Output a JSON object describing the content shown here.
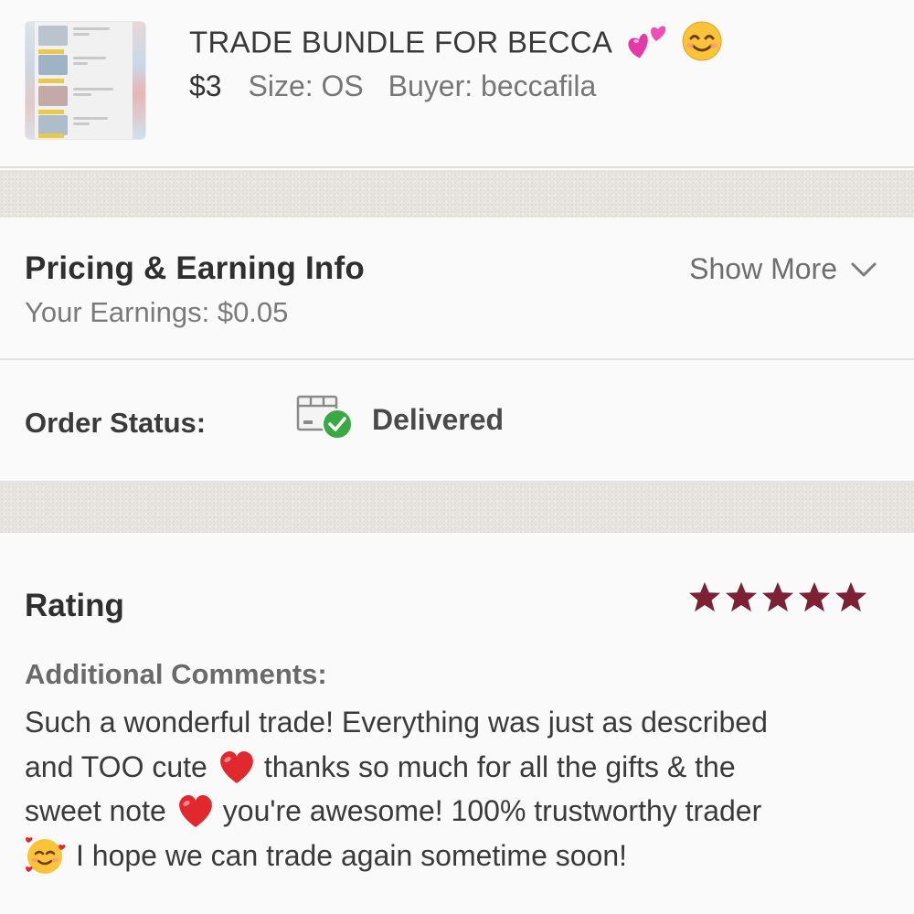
{
  "listing": {
    "title": "TRADE BUNDLE FOR BECCA",
    "price": "$3",
    "size": "Size: OS",
    "buyer": "Buyer: beccafila",
    "title_emojis": [
      "two-hearts-icon",
      "smiling-face-icon"
    ]
  },
  "pricing": {
    "title": "Pricing & Earning Info",
    "earnings": "Your Earnings: $0.05",
    "show_more": "Show More"
  },
  "order": {
    "label": "Order Status:",
    "status": "Delivered",
    "status_icon": "package-delivered-icon"
  },
  "rating": {
    "title": "Rating",
    "stars": 5,
    "star_color": "#7b2133",
    "comments_label": "Additional Comments:",
    "comment_lines": [
      "Such a wonderful trade! Everything was just as described",
      "and TOO cute",
      "thanks so much for all the gifts & the",
      "sweet note",
      "you're awesome! 100% trustworthy trader",
      "I hope we can trade again sometime soon!"
    ]
  },
  "colors": {
    "background": "#fafafa",
    "separator": "#e8e5e0",
    "delivered_green": "#3aa845",
    "heart_red": "#e0282e"
  }
}
